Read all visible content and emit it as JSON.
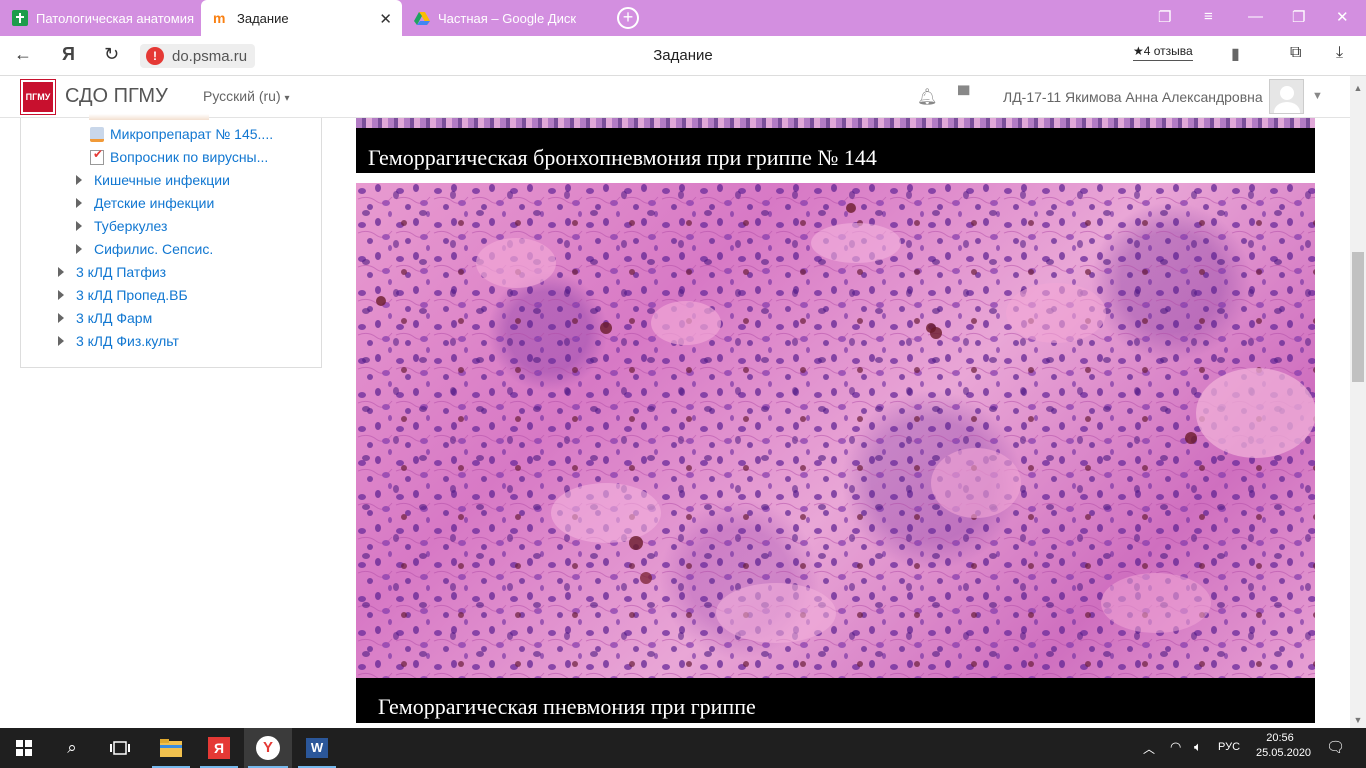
{
  "browser": {
    "tabs": [
      {
        "label": "Патологическая анатомия",
        "active": false
      },
      {
        "label": "Задание",
        "active": true
      },
      {
        "label": "Частная – Google Диск",
        "active": false
      }
    ],
    "url": "do.psma.ru",
    "page_title": "Задание",
    "reviews": "4 отзыва"
  },
  "moodle": {
    "site_name": "СДО ПГМУ",
    "language": "Русский (ru)",
    "user_name": "ЛД-17-11 Якимова Анна Александровна",
    "logo_text": "ПГМУ"
  },
  "sidebar": {
    "items": [
      {
        "label": "Микропрепарат № 145....",
        "kind": "file"
      },
      {
        "label": "Вопросник по вирусны...",
        "kind": "quiz"
      },
      {
        "label": "Кишечные инфекции",
        "kind": "section"
      },
      {
        "label": "Детские инфекции",
        "kind": "section"
      },
      {
        "label": "Туберкулез",
        "kind": "section"
      },
      {
        "label": "Сифилис. Сепсис.",
        "kind": "section"
      },
      {
        "label": "3 кЛД Патфиз",
        "kind": "course"
      },
      {
        "label": "3 кЛД Пропед.ВБ",
        "kind": "course"
      },
      {
        "label": "3 кЛД Фарм",
        "kind": "course"
      },
      {
        "label": "3 кЛД Физ.культ",
        "kind": "course"
      }
    ]
  },
  "content": {
    "caption1": "Геморрагическая бронхопневмония при гриппе № 144",
    "caption2": "Геморрагическая пневмония при гриппе"
  },
  "taskbar": {
    "language": "РУС",
    "time": "20:56",
    "date": "25.05.2020"
  },
  "colors": {
    "tabbar": "#d38fe0",
    "link": "#1177d1",
    "taskbar": "#1f1f1f"
  }
}
